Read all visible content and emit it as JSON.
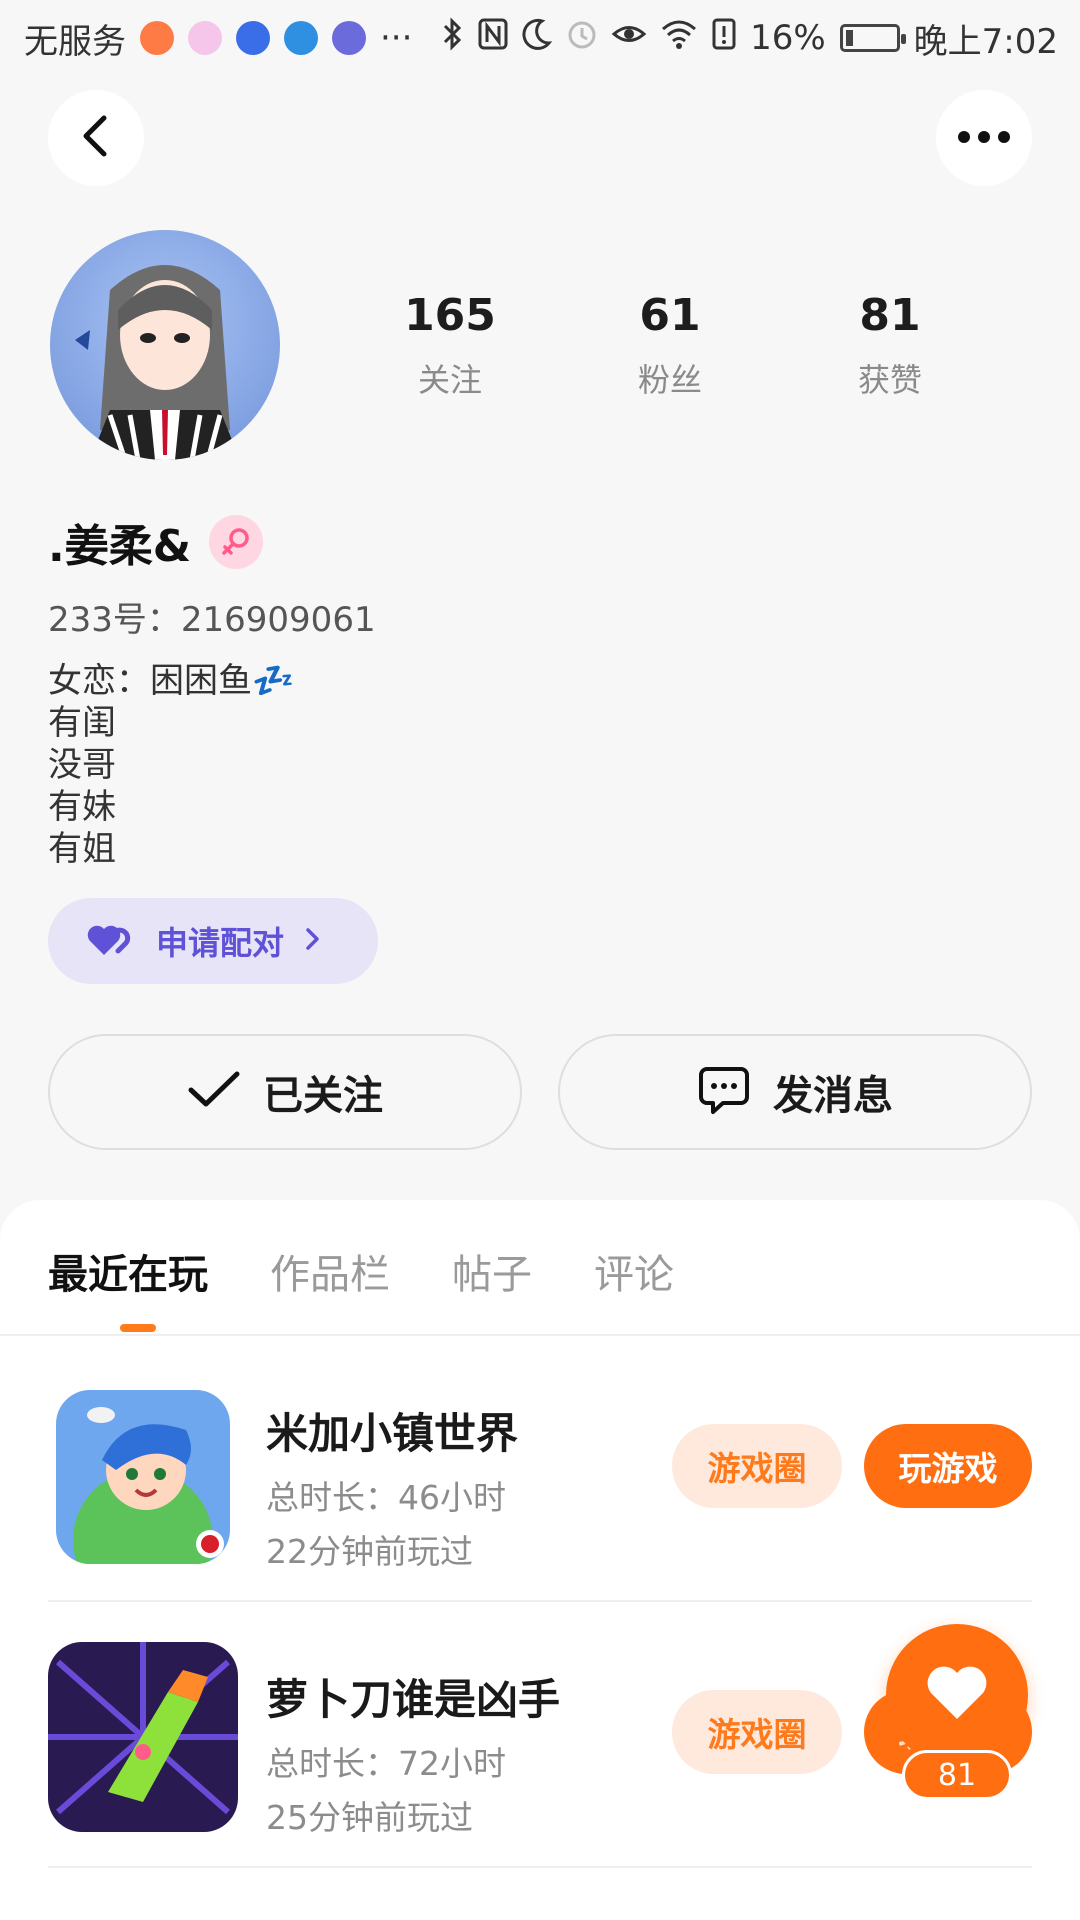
{
  "status_bar": {
    "carrier": "无服务",
    "overflow": "···",
    "battery": "16%",
    "time": "晚上7:02"
  },
  "profile": {
    "stats": [
      {
        "value": "165",
        "label": "关注"
      },
      {
        "value": "61",
        "label": "粉丝"
      },
      {
        "value": "81",
        "label": "获赞"
      }
    ],
    "username": ".姜柔&",
    "uid": "233号：216909061",
    "bio": [
      "女恋：困困鱼💤",
      "有闺",
      "没哥",
      "有妹",
      "有姐"
    ],
    "match_label": "申请配对",
    "follow_label": "已关注",
    "message_label": "发消息"
  },
  "tabs": [
    {
      "label": "最近在玩",
      "active": true
    },
    {
      "label": "作品栏",
      "active": false
    },
    {
      "label": "帖子",
      "active": false
    },
    {
      "label": "评论",
      "active": false
    }
  ],
  "games": [
    {
      "title": "米加小镇世界",
      "total": "总时长：46小时",
      "last_played": "22分钟前玩过",
      "circle_label": "游戏圈",
      "play_label": "玩游戏"
    },
    {
      "title": "萝卜刀谁是凶手",
      "total": "总时长：72小时",
      "last_played": "25分钟前玩过",
      "circle_label": "游戏圈",
      "play_label": "玩游戏"
    }
  ],
  "like_count": "81",
  "colors": {
    "accent": "#ff6f12",
    "accent_light": "#ffe8dc",
    "match_bg": "#e7e4f8",
    "match_text": "#5f52d6"
  }
}
